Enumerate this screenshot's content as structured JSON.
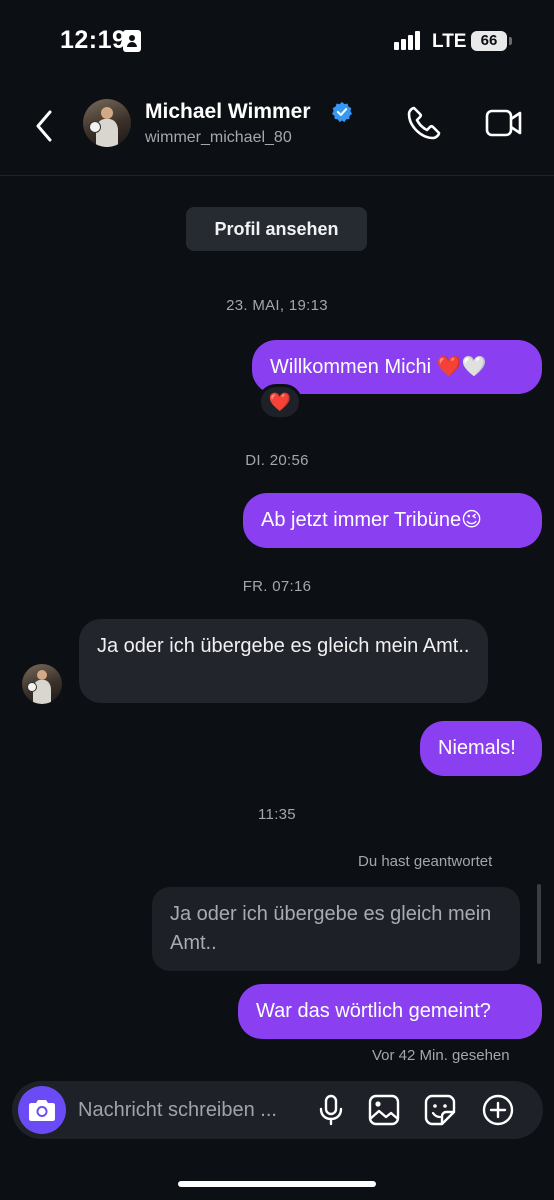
{
  "status_bar": {
    "time": "12:19",
    "network": "LTE",
    "battery": "66"
  },
  "header": {
    "contact_name": "Michael Wimmer",
    "contact_handle": "wimmer_michael_80",
    "verified": true
  },
  "chat": {
    "profile_button": "Profil ansehen",
    "timestamps": [
      "23. MAI, 19:13",
      "DI. 20:56",
      "FR. 07:16",
      "11:35"
    ],
    "messages": [
      {
        "text": "Willkommen Michi ❤️🤍",
        "direction": "outgoing",
        "reaction": "❤️"
      },
      {
        "text": "Ab jetzt immer Tribüne😉",
        "direction": "outgoing"
      },
      {
        "text": "Ja oder ich übergebe es gleich mein Amt..",
        "direction": "incoming"
      },
      {
        "text": "Niemals!",
        "direction": "outgoing"
      },
      {
        "text": "War das wörtlich gemeint?",
        "direction": "outgoing",
        "reply_to": "Ja oder ich übergebe es gleich mein Amt.."
      }
    ],
    "reply_label": "Du hast geantwortet",
    "seen_status": "Vor 42 Min. gesehen"
  },
  "composer": {
    "placeholder": "Nachricht schreiben ..."
  },
  "colors": {
    "background": "#0c0f14",
    "outgoing_bubble": "#8a3ff0",
    "incoming_bubble": "#22252c",
    "camera_button": "#6a4bf6",
    "verified_badge": "#3897f0"
  },
  "icons": [
    "back-arrow-icon",
    "verified-badge-icon",
    "phone-icon",
    "video-camera-icon",
    "camera-icon",
    "microphone-icon",
    "image-icon",
    "sticker-icon",
    "plus-circle-icon"
  ]
}
